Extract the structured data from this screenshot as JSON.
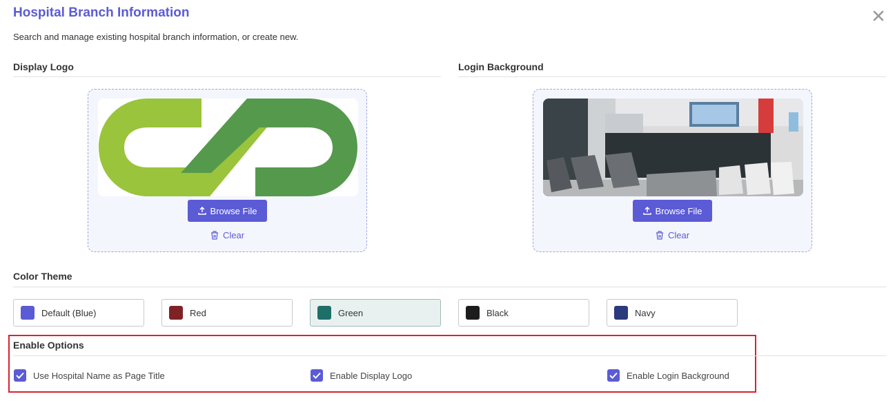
{
  "header": {
    "title": "Hospital Branch Information",
    "subtitle": "Search and manage existing hospital branch information, or create new."
  },
  "display_logo": {
    "title": "Display Logo",
    "browse_label": "Browse File",
    "clear_label": "Clear"
  },
  "login_background": {
    "title": "Login Background",
    "browse_label": "Browse File",
    "clear_label": "Clear"
  },
  "color_theme": {
    "title": "Color Theme",
    "options": [
      {
        "label": "Default (Blue)",
        "color": "#5b5bd6"
      },
      {
        "label": "Red",
        "color": "#7f2226"
      },
      {
        "label": "Green",
        "color": "#1f6f69"
      },
      {
        "label": "Black",
        "color": "#1c1c1c"
      },
      {
        "label": "Navy",
        "color": "#2b3a7c"
      }
    ],
    "selected": "Green"
  },
  "enable_options": {
    "title": "Enable Options",
    "items": [
      {
        "label": "Use Hospital Name as Page Title",
        "checked": true
      },
      {
        "label": "Enable Display Logo",
        "checked": true
      },
      {
        "label": "Enable Login Background",
        "checked": true
      }
    ]
  },
  "colors": {
    "accent": "#5b5bd6",
    "highlight_border": "#d6222f"
  }
}
